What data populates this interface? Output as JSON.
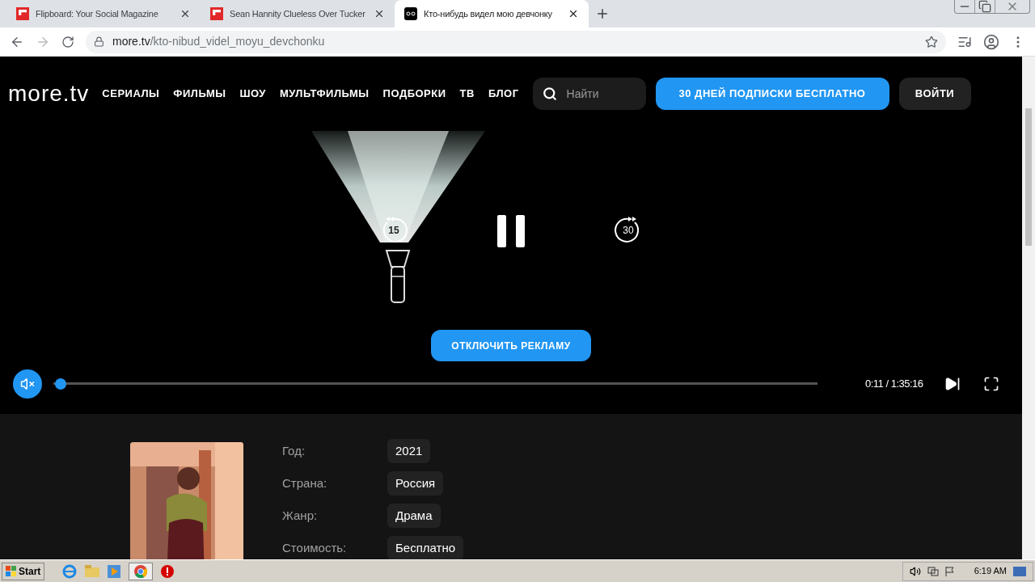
{
  "browser": {
    "tabs": [
      {
        "title": "Flipboard: Your Social Magazine",
        "selected": false
      },
      {
        "title": "Sean Hannity Clueless Over Tucker",
        "selected": false
      },
      {
        "title": "Кто-нибудь видел мою девчонку",
        "selected": true
      }
    ],
    "url_host": "more.tv",
    "url_path": "/kto-nibud_videl_moyu_devchonku"
  },
  "site": {
    "logo": "more.tv",
    "nav": [
      "СЕРИАЛЫ",
      "ФИЛЬМЫ",
      "ШОУ",
      "МУЛЬТФИЛЬМЫ",
      "ПОДБОРКИ",
      "ТВ",
      "БЛОГ"
    ],
    "search": {
      "placeholder": "Найти"
    },
    "promo_button": "30 ДНЕЙ ПОДПИСКИ БЕСПЛАТНО",
    "login_button": "ВОЙТИ"
  },
  "player": {
    "rewind_label": "15",
    "forward_label": "30",
    "ad_button": "ОТКЛЮЧИТЬ РЕКЛАМУ",
    "muted": true,
    "progress": {
      "level": 0.002
    },
    "time": "0:11 / 1:35:16"
  },
  "details": [
    {
      "label": "Год:",
      "value": "2021"
    },
    {
      "label": "Страна:",
      "value": "Россия"
    },
    {
      "label": "Жанр:",
      "value": "Драма"
    },
    {
      "label": "Стоимость:",
      "value": "Бесплатно"
    }
  ],
  "taskbar": {
    "start": "Start",
    "clock": "6:19 AM"
  }
}
